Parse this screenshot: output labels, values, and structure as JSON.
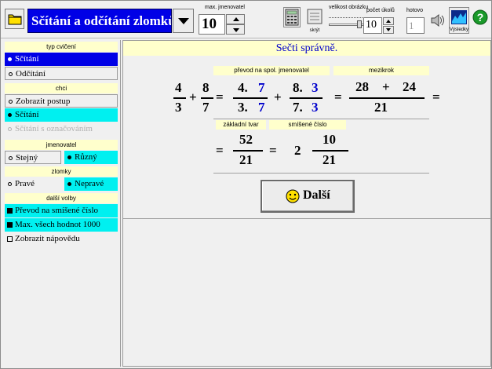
{
  "toolbar": {
    "title": "Sčítání a odčítání zlomků",
    "max_denominator_label": "max. jmenovatel",
    "max_denominator_value": "10",
    "image_size_label": "velikost obrázku",
    "hide_label": "skrýt",
    "exercise_count_label": "počet úkolů",
    "exercise_count_value": "10",
    "done_label": "hotovo",
    "done_value": "1",
    "results_label": "Výsledky"
  },
  "left_panel": {
    "exercise_type": {
      "header": "typ cvičení",
      "options": [
        "Sčítání",
        "Odčítání"
      ]
    },
    "want": {
      "header": "chci",
      "options": [
        "Zobrazit postup",
        "Sčítání",
        "Sčítání s označováním"
      ]
    },
    "denominator": {
      "header": "jmenovatel",
      "options": [
        "Stejný",
        "Různý"
      ]
    },
    "fractions": {
      "header": "zlomky",
      "options": [
        "Pravé",
        "Nepravé"
      ]
    },
    "more": {
      "header": "další volby",
      "options": [
        "Převod na smíšené číslo",
        "Max. všech hodnot 1000",
        "Zobrazit nápovědu"
      ]
    }
  },
  "main": {
    "banner": "Sečti správně.",
    "label_common": "převod na spol. jmenovatel",
    "label_intermediate": "mezikrok",
    "label_basic": "základní tvar",
    "label_mixed": "smíšené číslo",
    "f1_num": "4",
    "f1_den": "3",
    "plus": "+",
    "eq": "=",
    "f2_num": "8",
    "f2_den": "7",
    "c1_num_a": "4.",
    "c1_num_b": "7",
    "c1_den_a": "3.",
    "c1_den_b": "7",
    "c2_num_a": "8.",
    "c2_num_b": "3",
    "c2_den_a": "7.",
    "c2_den_b": "3",
    "mid_num_a": "28",
    "mid_num_b": "24",
    "mid_den": "21",
    "basic_num": "52",
    "basic_den": "21",
    "mixed_whole": "2",
    "mixed_num": "10",
    "mixed_den": "21",
    "next_button": "Další"
  },
  "colors": {
    "title_bg": "#0000e6",
    "selected_blue": "#0000e6",
    "selected_cyan": "#00f0f0",
    "label_bg": "#ffffcc",
    "blue_digit": "#0000cc"
  },
  "icons": [
    "folder-icon",
    "chevron-down-icon",
    "calculator-icon",
    "hide-icon",
    "speaker-icon",
    "results-icon",
    "help-icon",
    "smiley-icon"
  ]
}
